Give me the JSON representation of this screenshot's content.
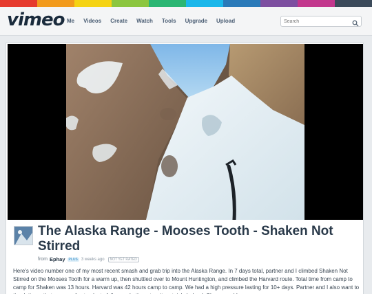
{
  "brand": {
    "logo": "vimeo"
  },
  "nav": {
    "items": [
      "Me",
      "Videos",
      "Create",
      "Watch",
      "Tools",
      "Upgrade",
      "Upload"
    ]
  },
  "search": {
    "placeholder": "Search"
  },
  "video": {
    "title": "The Alaska Range - Mooses Tooth - Shaken Not Stirred",
    "byline_prefix": "from",
    "author": "Ephay",
    "author_badge": "PLUS",
    "time_ago": "3 weeks ago",
    "rating": "NOT YET RATED",
    "description": "Here's video number one of my most recent smash and grab trip into the Alaska Range. In 7 days total, partner and I climbed Shaken Not Stirred on the Mooses Tooth for a warm up, then shuttled over to Mount Huntington, and climbed the Harvard route. Total time from camp to camp for Shaken was 13 hours. Harvard was 42 hours camp to camp. We had a high pressure lasting for 10+ days. Partner and I also want to thank those that gave us the tracks to follow up both routes, it certainly helped. Cheers and I"
  },
  "colors": {
    "rainbow": [
      "#e63b2e",
      "#f29b1d",
      "#f5d314",
      "#8cc63f",
      "#2bb673",
      "#1ab7ea",
      "#2a7ab9",
      "#7d4fa0",
      "#c2378d",
      "#3b4a5a"
    ],
    "accent": "#1ab7ea"
  },
  "icons": {
    "search": "search-icon"
  }
}
